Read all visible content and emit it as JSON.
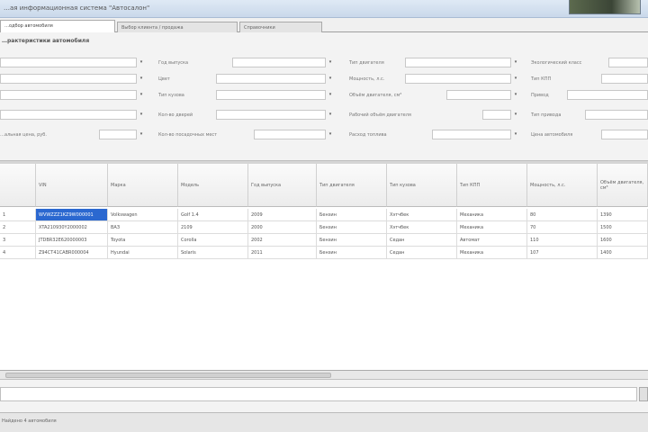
{
  "window": {
    "title": "…ая информационная система \"Автосалон\""
  },
  "tabs": [
    "…одбор автомобиля",
    "Выбор клиента / продажа",
    "Справочники"
  ],
  "filters": {
    "section_title": "…рактеристики автомобиля",
    "fields": [
      {
        "label": ""
      },
      {
        "label": ""
      },
      {
        "label": ""
      },
      {
        "label": ""
      },
      {
        "label": "…альная цена, руб."
      },
      {
        "label": "Год выпуска"
      },
      {
        "label": "Цвет"
      },
      {
        "label": "Тип кузова"
      },
      {
        "label": "Кол-во дверей"
      },
      {
        "label": "Кол-во посадочных мест"
      },
      {
        "label": "Тип двигателя"
      },
      {
        "label": "Мощность, л.с."
      },
      {
        "label": "Объём двигателя, см³"
      },
      {
        "label": "Рабочий объём двигателя"
      },
      {
        "label": "Расход топлива"
      },
      {
        "label": "Экологический класс"
      },
      {
        "label": "Тип КПП"
      },
      {
        "label": "Привод"
      },
      {
        "label": "Тип привода"
      },
      {
        "label": "Цена автомобиля"
      }
    ],
    "dropdown_glyph": "▾"
  },
  "grid": {
    "columns": [
      "",
      "VIN",
      "Марка",
      "Модель",
      "Год выпуска",
      "Тип двигателя",
      "Тип кузова",
      "Тип КПП",
      "Мощность, л.с.",
      "Объём двигателя, см³"
    ],
    "rows": [
      [
        "1",
        "WVWZZZ1KZ9W000001",
        "Volkswagen",
        "Golf 1.4",
        "2009",
        "Бензин",
        "Хэтчбек",
        "Механика",
        "80",
        "1390"
      ],
      [
        "2",
        "XTA210930Y2000002",
        "ВАЗ",
        "2109",
        "2000",
        "Бензин",
        "Хэтчбек",
        "Механика",
        "70",
        "1500"
      ],
      [
        "3",
        "JTDBR32E620000003",
        "Toyota",
        "Corolla",
        "2002",
        "Бензин",
        "Седан",
        "Автомат",
        "110",
        "1600"
      ],
      [
        "4",
        "Z94CT41CABR000004",
        "Hyundai",
        "Solaris",
        "2011",
        "Бензин",
        "Седан",
        "Механика",
        "107",
        "1400"
      ]
    ],
    "selected_cell": "WVWZZZ1KZ9W000001"
  },
  "statusbar": {
    "text": "Найдено 4 автомобиля"
  },
  "colors": {
    "selection": "#2b68d0",
    "window_frame": "#c9d8ea"
  }
}
